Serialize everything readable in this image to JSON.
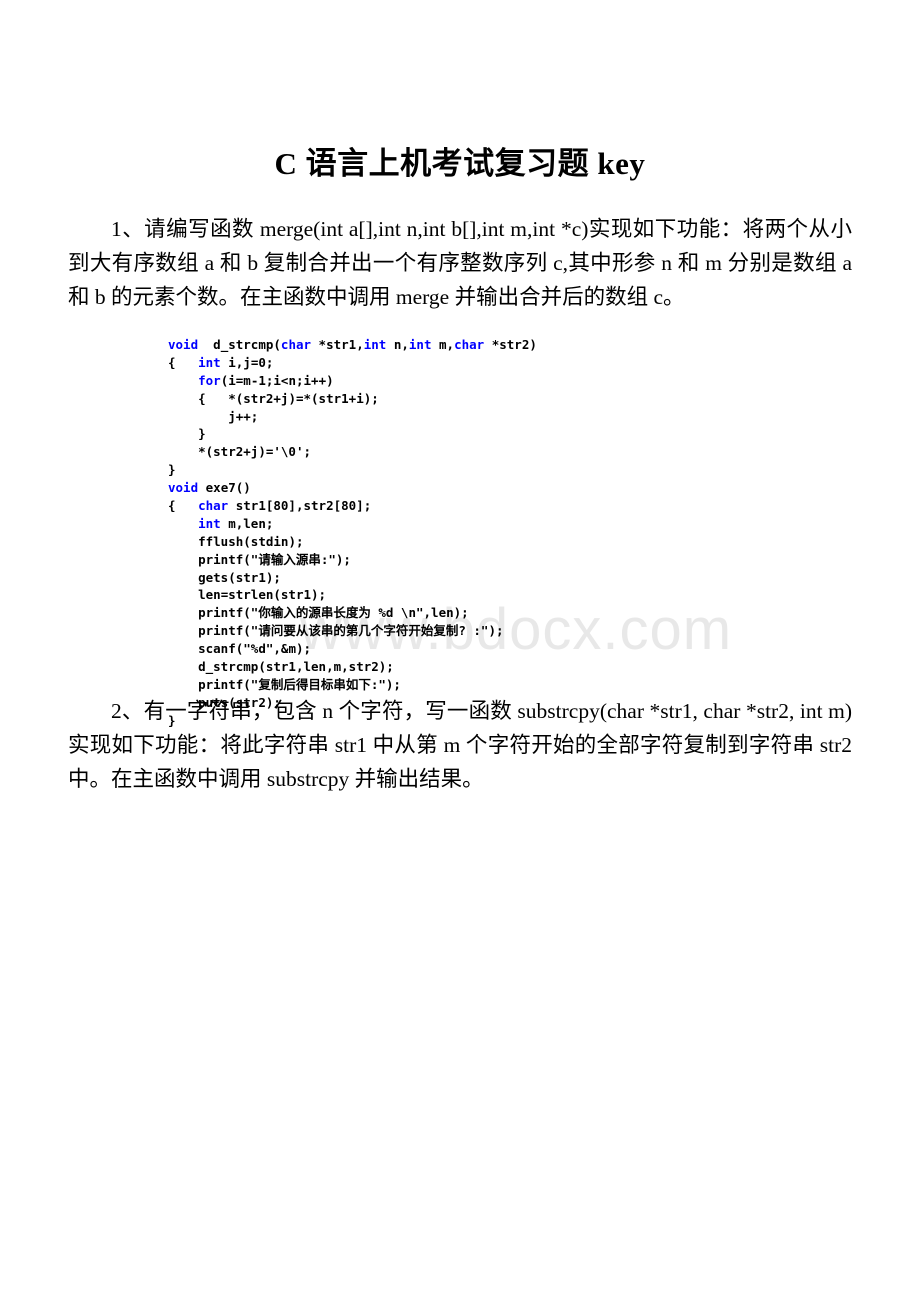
{
  "document": {
    "title": "C 语言上机考试复习题 key",
    "watermark": "www.bdocx.com",
    "paragraphs": {
      "item1": "1、请编写函数 merge(int a[],int n,int b[],int m,int *c)实现如下功能：将两个从小到大有序数组 a 和 b 复制合并出一个有序整数序列 c,其中形参 n 和 m 分别是数组 a 和 b 的元素个数。在主函数中调用 merge 并输出合并后的数组 c。",
      "item2": "2、有一字符串，包含 n 个字符，写一函数 substrcpy(char *str1, char *str2, int m)实现如下功能：将此字符串 str1 中从第 m 个字符开始的全部字符复制到字符串 str2 中。在主函数中调用 substrcpy 并输出结果。"
    },
    "code": {
      "language": "c",
      "keyword_color": "#0000ff",
      "text_color": "#000000",
      "lines": [
        {
          "kw": "void",
          "rest": "  d_strcmp(",
          "kw2": "char",
          "rest2": " *str1,",
          "kw3": "int",
          "rest3": " n,",
          "kw4": "int",
          "rest4": " m,",
          "kw5": "char",
          "rest5": " *str2)"
        },
        {
          "text": "{   int i,j=0;"
        },
        {
          "text": "    for(i=m-1;i<n;i++)"
        },
        {
          "text": "    {   *(str2+j)=*(str1+i);"
        },
        {
          "text": "        j++;"
        },
        {
          "text": "    }"
        },
        {
          "text": "    *(str2+j)='\\0';"
        },
        {
          "text": "}"
        },
        {
          "text": "void exe7()"
        },
        {
          "text": "{   char str1[80],str2[80];"
        },
        {
          "text": "    int m,len;"
        },
        {
          "text": "    fflush(stdin);"
        },
        {
          "text": "    printf(\"请输入源串:\");"
        },
        {
          "text": "    gets(str1);"
        },
        {
          "text": "    len=strlen(str1);"
        },
        {
          "text": "    printf(\"你输入的源串长度为 %d \\n\",len);"
        },
        {
          "text": "    printf(\"请问要从该串的第几个字符开始复制? :\");"
        },
        {
          "text": "    scanf(\"%d\",&m);"
        },
        {
          "text": "    d_strcmp(str1,len,m,str2);"
        },
        {
          "text": "    printf(\"复制后得目标串如下:\");"
        },
        {
          "text": "    puts(str2);"
        },
        {
          "text": "}"
        }
      ],
      "line_texts": [
        "void  d_strcmp(char *str1,int n,int m,char *str2)",
        "{   int i,j=0;",
        "    for(i=m-1;i<n;i++)",
        "    {   *(str2+j)=*(str1+i);",
        "        j++;",
        "    }",
        "    *(str2+j)='\\0';",
        "}",
        "void exe7()",
        "{   char str1[80],str2[80];",
        "    int m,len;",
        "    fflush(stdin);",
        "    printf(\"请输入源串:\");",
        "    gets(str1);",
        "    len=strlen(str1);",
        "    printf(\"你输入的源串长度为 %d \\n\",len);",
        "    printf(\"请问要从该串的第几个字符开始复制? :\");",
        "    scanf(\"%d\",&m);",
        "    d_strcmp(str1,len,m,str2);",
        "    printf(\"复制后得目标串如下:\");",
        "    puts(str2);",
        "}"
      ]
    }
  }
}
